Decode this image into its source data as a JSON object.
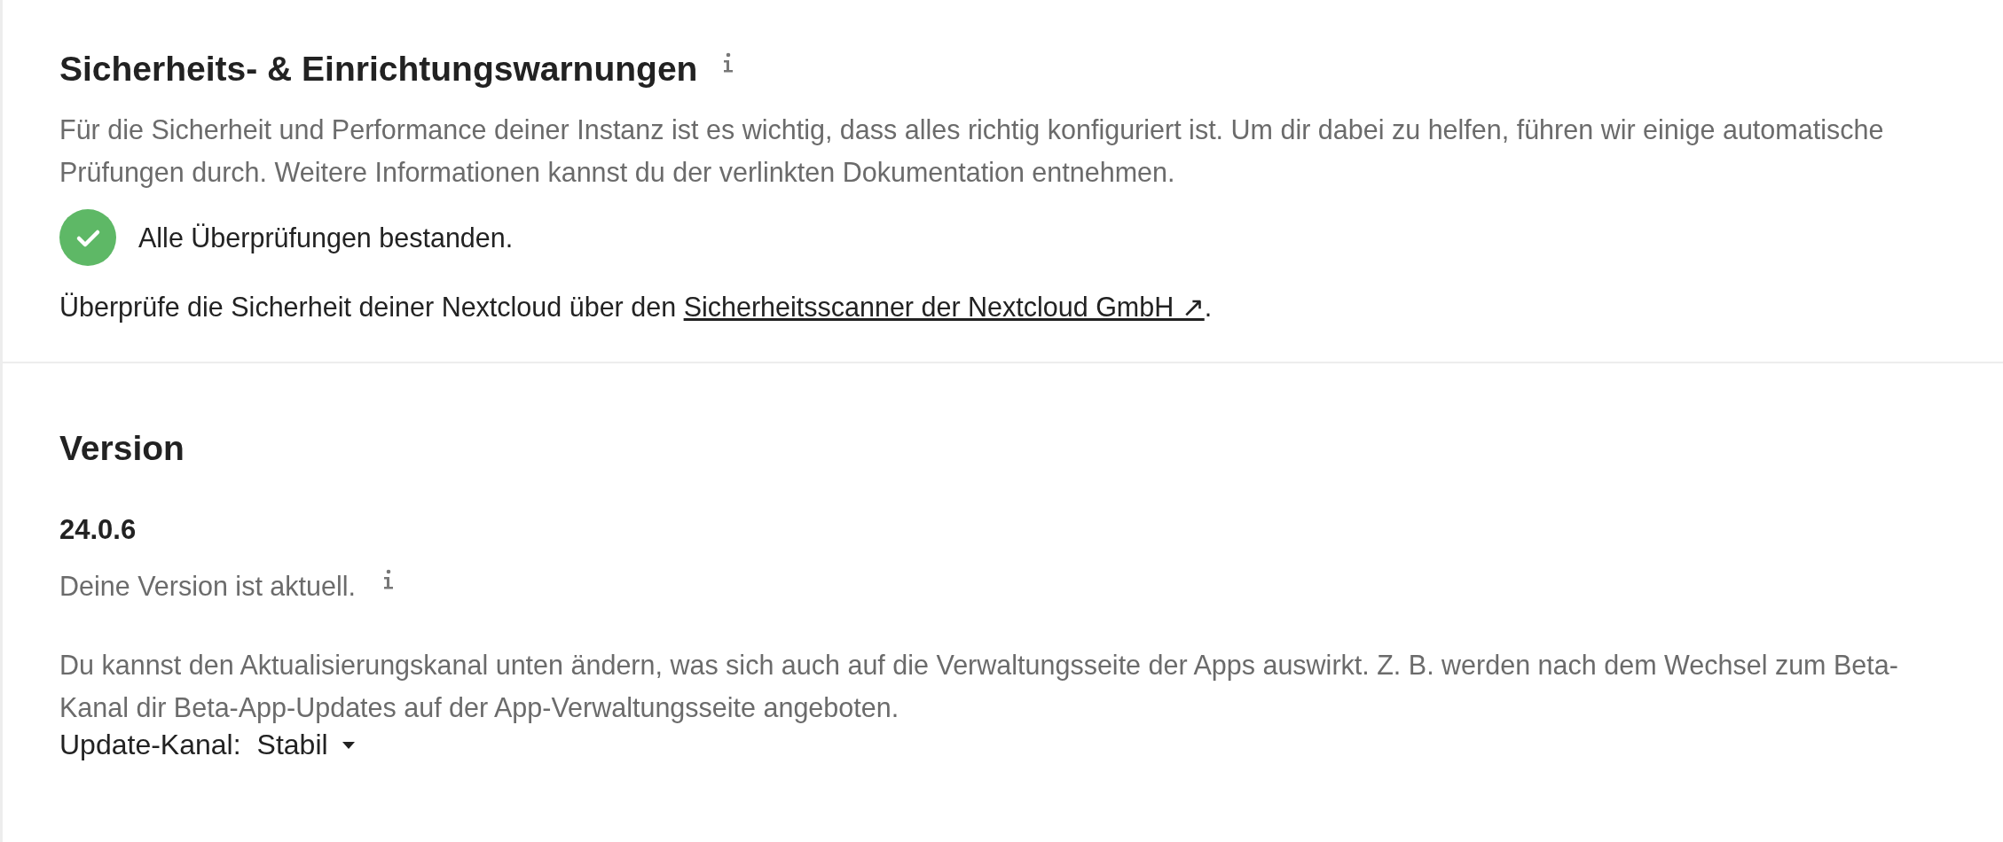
{
  "security": {
    "title": "Sicherheits- & Einrichtungswarnungen",
    "description": "Für die Sicherheit und Performance deiner Instanz ist es wichtig, dass alles richtig konfiguriert ist. Um dir dabei zu helfen, führen wir einige automatische Prüfungen durch. Weitere Informationen kannst du der verlinkten Dokumentation entnehmen.",
    "passed": true,
    "status_text": "Alle Überprüfungen bestanden.",
    "scan_text": "Überprüfe die Sicherheit deiner Nextcloud über den ",
    "scan_link": "Sicherheitsscanner der Nextcloud GmbH ↗",
    "scan_end": "."
  },
  "version": {
    "title": "Version",
    "number": "24.0.6",
    "status_text": "Deine Version ist aktuell.",
    "channel_description": "Du kannst den Aktualisierungskanal unten ändern, was sich auch auf die Verwaltungsseite der Apps auswirkt. Z. B. werden nach dem Wechsel zum Beta-Kanal dir Beta-App-Updates auf der App-Verwaltungsseite angeboten.",
    "channel_label": "Update-Kanal:",
    "channel_value": "Stabil"
  }
}
